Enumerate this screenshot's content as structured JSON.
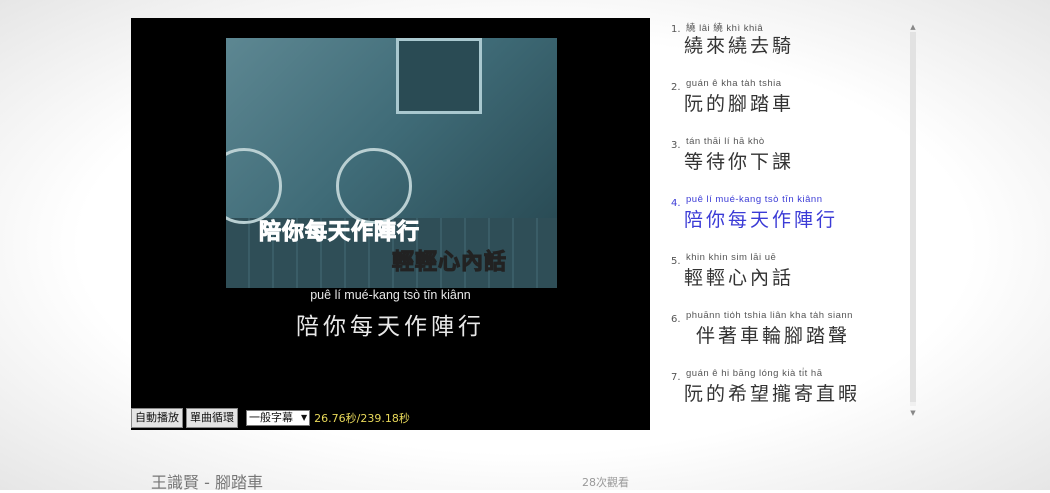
{
  "player": {
    "video_lyric_top": "陪你每天作陣行",
    "video_lyric_bottom": "輕輕心內話",
    "subtitle_pinyin": "puê   lí   mué-kang  tsò   tīn  kiânn",
    "subtitle_hanzi": "陪你每天作陣行",
    "controls": {
      "autoplay_label": "自動播放",
      "single_loop_label": "單曲循環",
      "subtitle_mode": "一般字幕",
      "time_current": "26.76秒",
      "time_total": "239.18秒",
      "time_separator": "/"
    }
  },
  "lyrics": [
    {
      "num": "1.",
      "pinyin": "繞    lâi     繞    khì  khiâ",
      "hanzi": "繞來繞去騎",
      "active": false
    },
    {
      "num": "2.",
      "pinyin": "guán ê   kha   ta̍h  tshia",
      "hanzi": "阮的腳踏車",
      "active": false
    },
    {
      "num": "3.",
      "pinyin": "tán thāi    lí      hā khò",
      "hanzi": "等待你下課",
      "active": false
    },
    {
      "num": "4.",
      "pinyin": "puê     lí    mué-kang  tsò    tīn  kiânn",
      "hanzi": "陪你每天作陣行",
      "active": true
    },
    {
      "num": "5.",
      "pinyin": "khin khin   sim lāi    uē",
      "hanzi": "輕輕心內話",
      "active": false
    },
    {
      "num": "6.",
      "pinyin": "phuānn tio̍h  tshia liân  kha   ta̍h  siann",
      "hanzi": "伴著車輪腳踏聲",
      "active": false
    },
    {
      "num": "7.",
      "pinyin": "guán ê   hi bāng  lóng  kià    ti̍t   hā",
      "hanzi": "阮的希望攏寄直暇",
      "active": false
    }
  ],
  "footer": {
    "song_title": "王識賢 - 腳踏車",
    "views": "28次觀看"
  }
}
